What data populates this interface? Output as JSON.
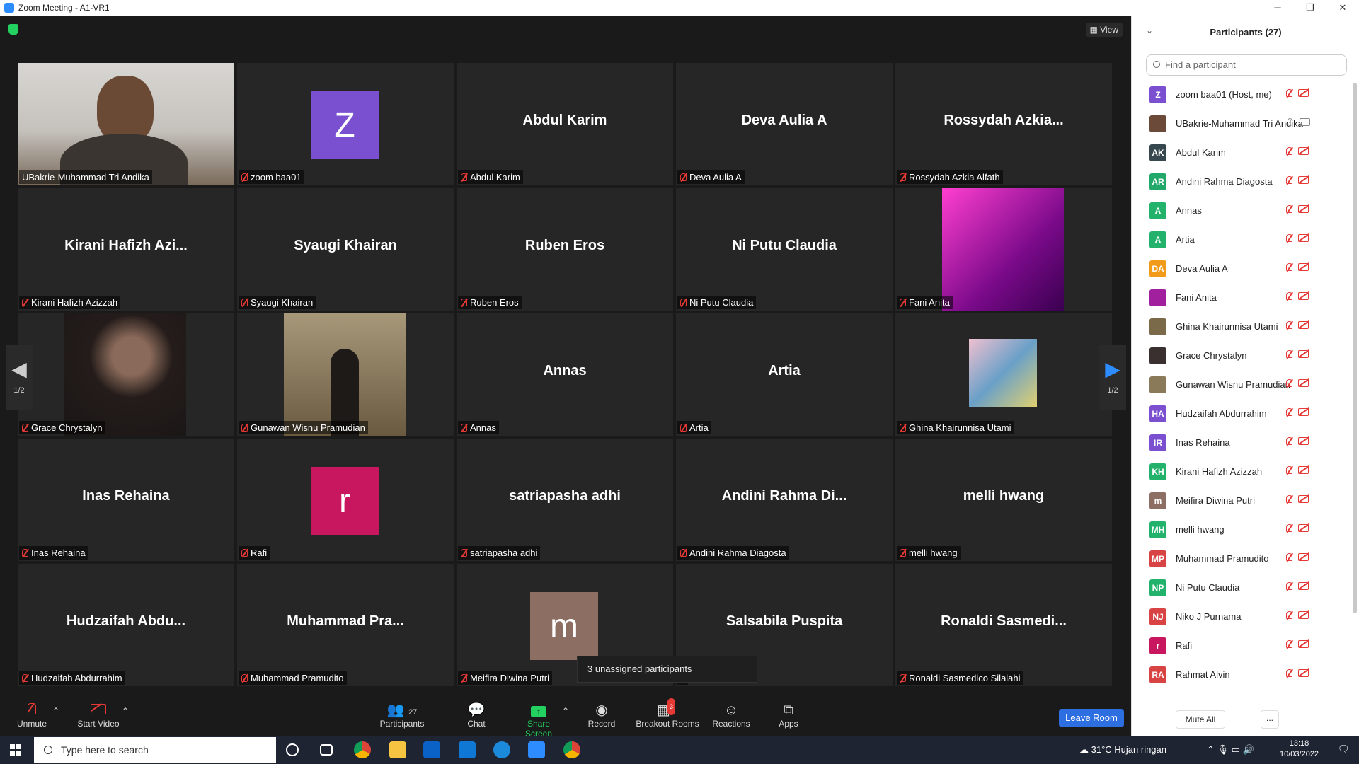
{
  "window": {
    "title": "Zoom Meeting - A1-VR1",
    "minimize": "─",
    "maximize": "❐",
    "close": "✕"
  },
  "meeting": {
    "view_label": "View",
    "page_indicator": "1/2",
    "tooltip": "3 unassigned participants",
    "tiles": [
      {
        "center": "",
        "name": "UBakrie-Muhammad Tri Andika",
        "kind": "video-main",
        "muted": false
      },
      {
        "center": "Z",
        "name": "zoom baa01",
        "kind": "avatar",
        "color": "#7a4fd0",
        "muted": true
      },
      {
        "center": "Abdul Karim",
        "name": "Abdul Karim",
        "kind": "name",
        "muted": true
      },
      {
        "center": "Deva Aulia A",
        "name": "Deva Aulia A",
        "kind": "name",
        "muted": true
      },
      {
        "center": "Rossydah  Azkia...",
        "name": "Rossydah Azkia Alfath",
        "kind": "name",
        "muted": true
      },
      {
        "center": "Kirani  Hafizh  Azi...",
        "name": "Kirani Hafizh Azizzah",
        "kind": "name",
        "muted": true
      },
      {
        "center": "Syaugi Khairan",
        "name": "Syaugi Khairan",
        "kind": "name",
        "muted": true
      },
      {
        "center": "Ruben Eros",
        "name": "Ruben Eros",
        "kind": "name",
        "muted": true
      },
      {
        "center": "Ni Putu Claudia",
        "name": "Ni Putu Claudia",
        "kind": "name",
        "muted": true
      },
      {
        "center": "",
        "name": "Fani Anita",
        "kind": "photo-pink",
        "muted": true
      },
      {
        "center": "",
        "name": "Grace Chrystalyn",
        "kind": "photo-dark",
        "muted": true
      },
      {
        "center": "",
        "name": "Gunawan Wisnu Pramudian",
        "kind": "photo-suit",
        "muted": true
      },
      {
        "center": "Annas",
        "name": "Annas",
        "kind": "name",
        "muted": true
      },
      {
        "center": "Artia",
        "name": "Artia",
        "kind": "name",
        "muted": true
      },
      {
        "center": "",
        "name": "Ghina Khairunnisa Utami",
        "kind": "photo-small",
        "muted": true
      },
      {
        "center": "Inas Rehaina",
        "name": "Inas Rehaina",
        "kind": "name",
        "muted": true
      },
      {
        "center": "r",
        "name": "Rafi",
        "kind": "avatar",
        "color": "#c9175f",
        "muted": true
      },
      {
        "center": "satriapasha adhi",
        "name": "satriapasha adhi",
        "kind": "name",
        "muted": true
      },
      {
        "center": "Andini  Rahma  Di...",
        "name": "Andini Rahma Diagosta",
        "kind": "name",
        "muted": true
      },
      {
        "center": "melli hwang",
        "name": "melli hwang",
        "kind": "name",
        "muted": true
      },
      {
        "center": "Hudzaifah  Abdu...",
        "name": "Hudzaifah Abdurrahim",
        "kind": "name",
        "muted": true
      },
      {
        "center": "Muhammad  Pra...",
        "name": "Muhammad Pramudito",
        "kind": "name",
        "muted": true
      },
      {
        "center": "m",
        "name": "Meifira Diwina Putri",
        "kind": "avatar",
        "color": "#8d6e63",
        "muted": true
      },
      {
        "center": "Salsabila Puspita",
        "name": "a",
        "kind": "name",
        "muted": false
      },
      {
        "center": "Ronaldi  Sasmedi...",
        "name": "Ronaldi Sasmedico Silalahi",
        "kind": "name",
        "muted": true
      }
    ]
  },
  "toolbar": {
    "unmute": "Unmute",
    "start_video": "Start Video",
    "participants": "Participants",
    "participants_count": "27",
    "chat": "Chat",
    "share_screen": "Share Screen",
    "record": "Record",
    "breakout_rooms": "Breakout Rooms",
    "breakout_badge": "3",
    "reactions": "Reactions",
    "apps": "Apps",
    "leave": "Leave Room"
  },
  "panel": {
    "title": "Participants (27)",
    "search_placeholder": "Find a participant",
    "mute_all": "Mute All",
    "more": "...",
    "participants": [
      {
        "initials": "Z",
        "color": "#7a4fd0",
        "name": "zoom baa01 (Host, me)",
        "status": "off"
      },
      {
        "initials": "",
        "color": "#6b4a3a",
        "name": "UBakrie-Muhammad Tri Andika",
        "status": "on"
      },
      {
        "initials": "AK",
        "color": "#37474f",
        "name": "Abdul Karim",
        "status": "off"
      },
      {
        "initials": "AR",
        "color": "#23a86b",
        "name": "Andini Rahma Diagosta",
        "status": "off"
      },
      {
        "initials": "A",
        "color": "#23b26b",
        "name": "Annas",
        "status": "off"
      },
      {
        "initials": "A",
        "color": "#23b26b",
        "name": "Artia",
        "status": "off"
      },
      {
        "initials": "DA",
        "color": "#f29b1a",
        "name": "Deva Aulia A",
        "status": "off"
      },
      {
        "initials": "",
        "color": "#a0209e",
        "name": "Fani Anita",
        "status": "off"
      },
      {
        "initials": "",
        "color": "#7a6a4a",
        "name": "Ghina Khairunnisa Utami",
        "status": "off"
      },
      {
        "initials": "",
        "color": "#3a3030",
        "name": "Grace Chrystalyn",
        "status": "off"
      },
      {
        "initials": "",
        "color": "#8a7a5a",
        "name": "Gunawan Wisnu Pramudian",
        "status": "off"
      },
      {
        "initials": "HA",
        "color": "#7a4fd0",
        "name": "Hudzaifah Abdurrahim",
        "status": "off"
      },
      {
        "initials": "IR",
        "color": "#7a4fd0",
        "name": "Inas Rehaina",
        "status": "off"
      },
      {
        "initials": "KH",
        "color": "#23b26b",
        "name": "Kirani Hafizh Azizzah",
        "status": "off"
      },
      {
        "initials": "m",
        "color": "#8d6e63",
        "name": "Meifira Diwina Putri",
        "status": "off"
      },
      {
        "initials": "MH",
        "color": "#23b26b",
        "name": "melli hwang",
        "status": "off"
      },
      {
        "initials": "MP",
        "color": "#d84343",
        "name": "Muhammad Pramudito",
        "status": "off"
      },
      {
        "initials": "NP",
        "color": "#23b26b",
        "name": "Ni Putu Claudia",
        "status": "off"
      },
      {
        "initials": "NJ",
        "color": "#d84343",
        "name": "Niko J Purnama",
        "status": "off"
      },
      {
        "initials": "r",
        "color": "#c9175f",
        "name": "Rafi",
        "status": "off"
      },
      {
        "initials": "RA",
        "color": "#d84343",
        "name": "Rahmat Alvin",
        "status": "off"
      }
    ]
  },
  "taskbar": {
    "search_placeholder": "Type here to search",
    "weather": "31°C  Hujan ringan",
    "time": "13:18",
    "date": "10/03/2022"
  }
}
